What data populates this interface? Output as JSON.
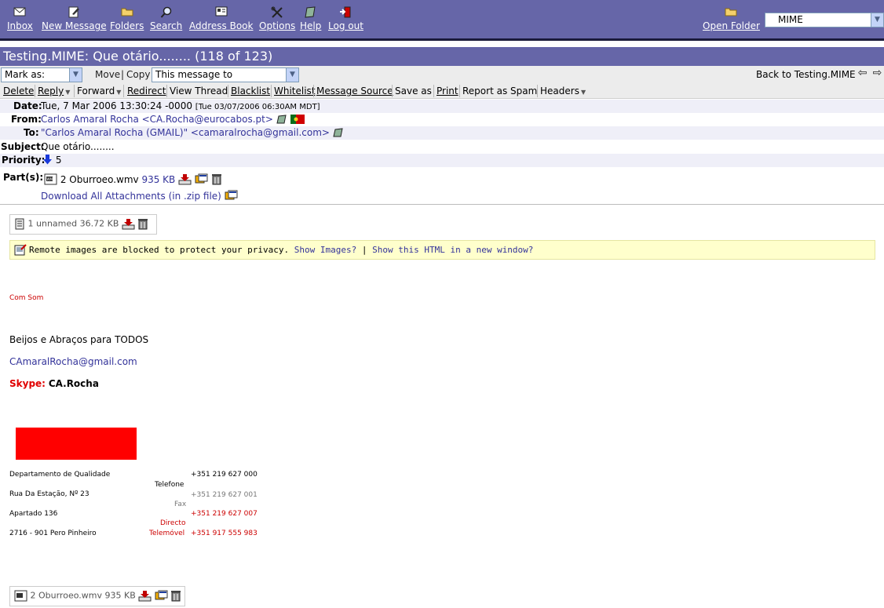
{
  "toolbar": {
    "items": [
      {
        "label": "Inbox",
        "icon": "envelope-icon"
      },
      {
        "label": "New Message",
        "icon": "compose-icon"
      },
      {
        "label": "Folders",
        "icon": "folder-icon"
      },
      {
        "label": "Search",
        "icon": "magnifier-icon"
      },
      {
        "label": "Address Book",
        "icon": "address-book-icon"
      },
      {
        "label": "Options",
        "icon": "tools-icon"
      },
      {
        "label": "Help",
        "icon": "help-book-icon"
      },
      {
        "label": "Log out",
        "icon": "logout-icon"
      }
    ],
    "open_folder_label": "Open Folder",
    "folder_select_value": "MIME"
  },
  "title": "Testing.MIME: Que otário........ (118 of 123)",
  "controls": {
    "mark_as": "Mark as:",
    "move": "Move",
    "separator": "|",
    "copy": "Copy",
    "copy_target": "This message to",
    "back_link": "Back to Testing.MIME"
  },
  "actions": {
    "delete": "Delete",
    "reply": "Reply",
    "forward": "Forward",
    "redirect": "Redirect",
    "view_thread": "View Thread",
    "blacklist": "Blacklist",
    "whitelist": "Whitelist",
    "message_source": "Message Source",
    "save_as": "Save as",
    "print": "Print",
    "report_spam": "Report as Spam",
    "headers": "Headers"
  },
  "headers": {
    "date_label": "Date:",
    "date_value": "Tue, 7 Mar 2006 13:30:24 -0000",
    "date_local": "[Tue 03/07/2006 06:30AM MDT]",
    "from_label": "From:",
    "from_value": "Carlos Amaral Rocha <CA.Rocha@eurocabos.pt>",
    "to_label": "To:",
    "to_value": "\"Carlos Amaral Rocha (GMAIL)\" <camaralrocha@gmail.com>",
    "subject_label": "Subject:",
    "subject_value": "Que otário........",
    "priority_label": "Priority:",
    "priority_value": "5",
    "parts_label": "Part(s):",
    "part_name": "2 Oburroeo.wmv",
    "part_size": "935 KB",
    "download_all": "Download All Attachments (in .zip file)"
  },
  "attachment_top": {
    "name": "1 unnamed",
    "size": "36.72 KB"
  },
  "remote_bar": {
    "text": "Remote images are blocked to protect your privacy.",
    "show_images": "Show Images?",
    "separator": "|",
    "show_html": "Show this HTML in a new window?"
  },
  "body": {
    "com_som": "Com Som",
    "beijos": "Beijos e Abraços para TODOS",
    "email": "CAmaralRocha@gmail.com",
    "skype_label": "Skype:",
    "skype_value": "CA.Rocha"
  },
  "signature": {
    "dept": "Departamento de Qualidade",
    "address": "Rua Da Estação, Nº 23",
    "apartado": "Apartado 136",
    "city": "2716 - 901 Pero Pinheiro",
    "phone1": "+351 219 627 000",
    "telefone_label": "Telefone",
    "phone2": "+351 219 627 001",
    "fax_label": "Fax",
    "phone3": "+351 219 627 007",
    "directo_label": "Directo",
    "telemovel_label": "Telemóvel",
    "phone4": "+351 917 555 983"
  },
  "attachment_bottom": {
    "name": "2 Oburroeo.wmv",
    "size": "935 KB"
  },
  "colors": {
    "header_bar": "#6666a8",
    "link": "#33339a",
    "red": "#cc0000"
  }
}
